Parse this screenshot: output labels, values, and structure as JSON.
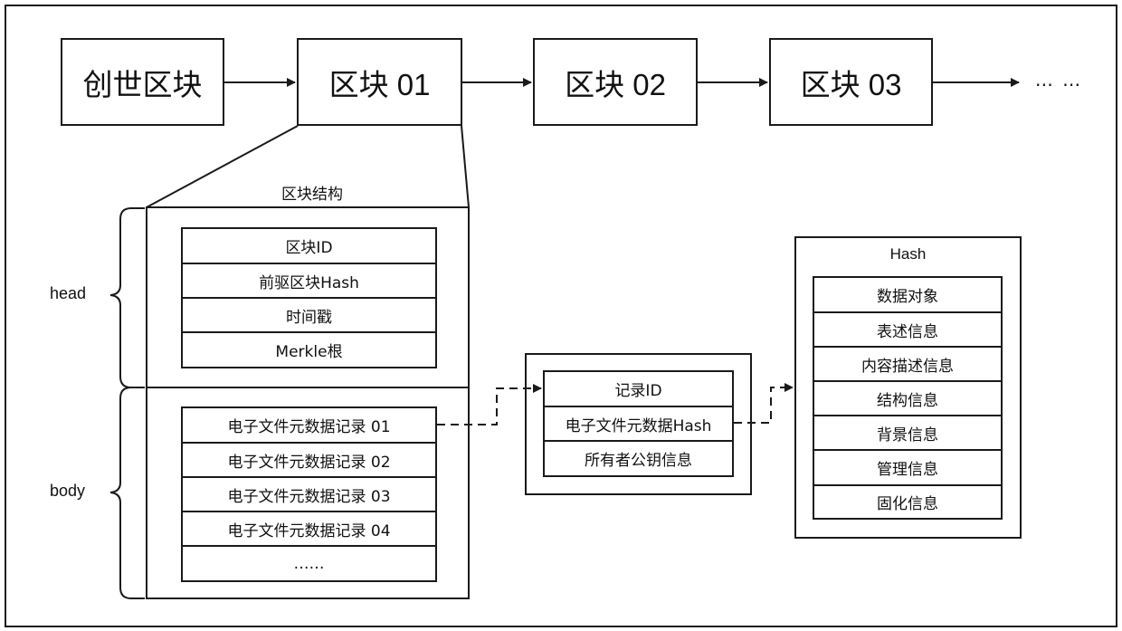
{
  "chain": {
    "blocks": [
      {
        "label": "创世区块"
      },
      {
        "label": "区块 01"
      },
      {
        "label": "区块 02"
      },
      {
        "label": "区块 03"
      }
    ],
    "continuation": "… …"
  },
  "block_structure": {
    "title": "区块结构",
    "head_label": "head",
    "body_label": "body",
    "head_fields": [
      "区块ID",
      "前驱区块Hash",
      "时间戳",
      "Merkle根"
    ],
    "body_records": [
      "电子文件元数据记录 01",
      "电子文件元数据记录 02",
      "电子文件元数据记录 03",
      "电子文件元数据记录 04",
      "……"
    ]
  },
  "record": {
    "fields": [
      "记录ID",
      "电子文件元数据Hash",
      "所有者公钥信息"
    ]
  },
  "hash": {
    "title": "Hash",
    "fields": [
      "数据对象",
      "表述信息",
      "内容描述信息",
      "结构信息",
      "背景信息",
      "管理信息",
      "固化信息"
    ]
  },
  "colors": {
    "stroke": "#1a1a1a",
    "background": "#ffffff"
  }
}
